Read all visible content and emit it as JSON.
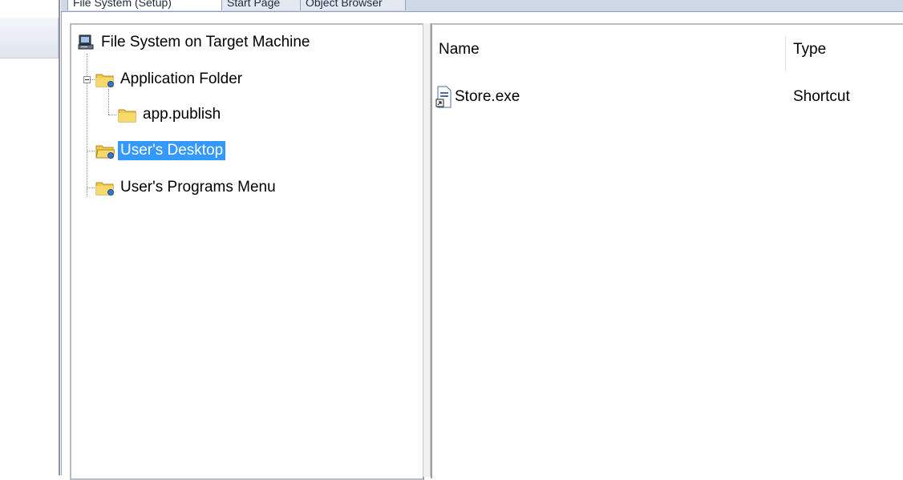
{
  "tabs": [
    {
      "label": "File System (Setup)",
      "active": true
    },
    {
      "label": "Start Page",
      "active": false
    },
    {
      "label": "Object Browser",
      "active": false
    }
  ],
  "tree": {
    "root": {
      "label": "File System on Target Machine",
      "icon": "computer-icon"
    },
    "items": [
      {
        "label": "Application Folder",
        "icon": "folder-icon",
        "expanded": true
      },
      {
        "label": "app.publish",
        "icon": "folder-icon"
      },
      {
        "label": "User's Desktop",
        "icon": "folder-icon",
        "selected": true
      },
      {
        "label": "User's Programs Menu",
        "icon": "folder-icon"
      }
    ]
  },
  "list": {
    "columns": [
      "Name",
      "Type"
    ],
    "rows": [
      {
        "name": "Store.exe",
        "type": "Shortcut",
        "icon": "shortcut-file-icon"
      }
    ]
  },
  "colors": {
    "selection": "#3399ff",
    "tab_strip": "#cfd8e6"
  }
}
